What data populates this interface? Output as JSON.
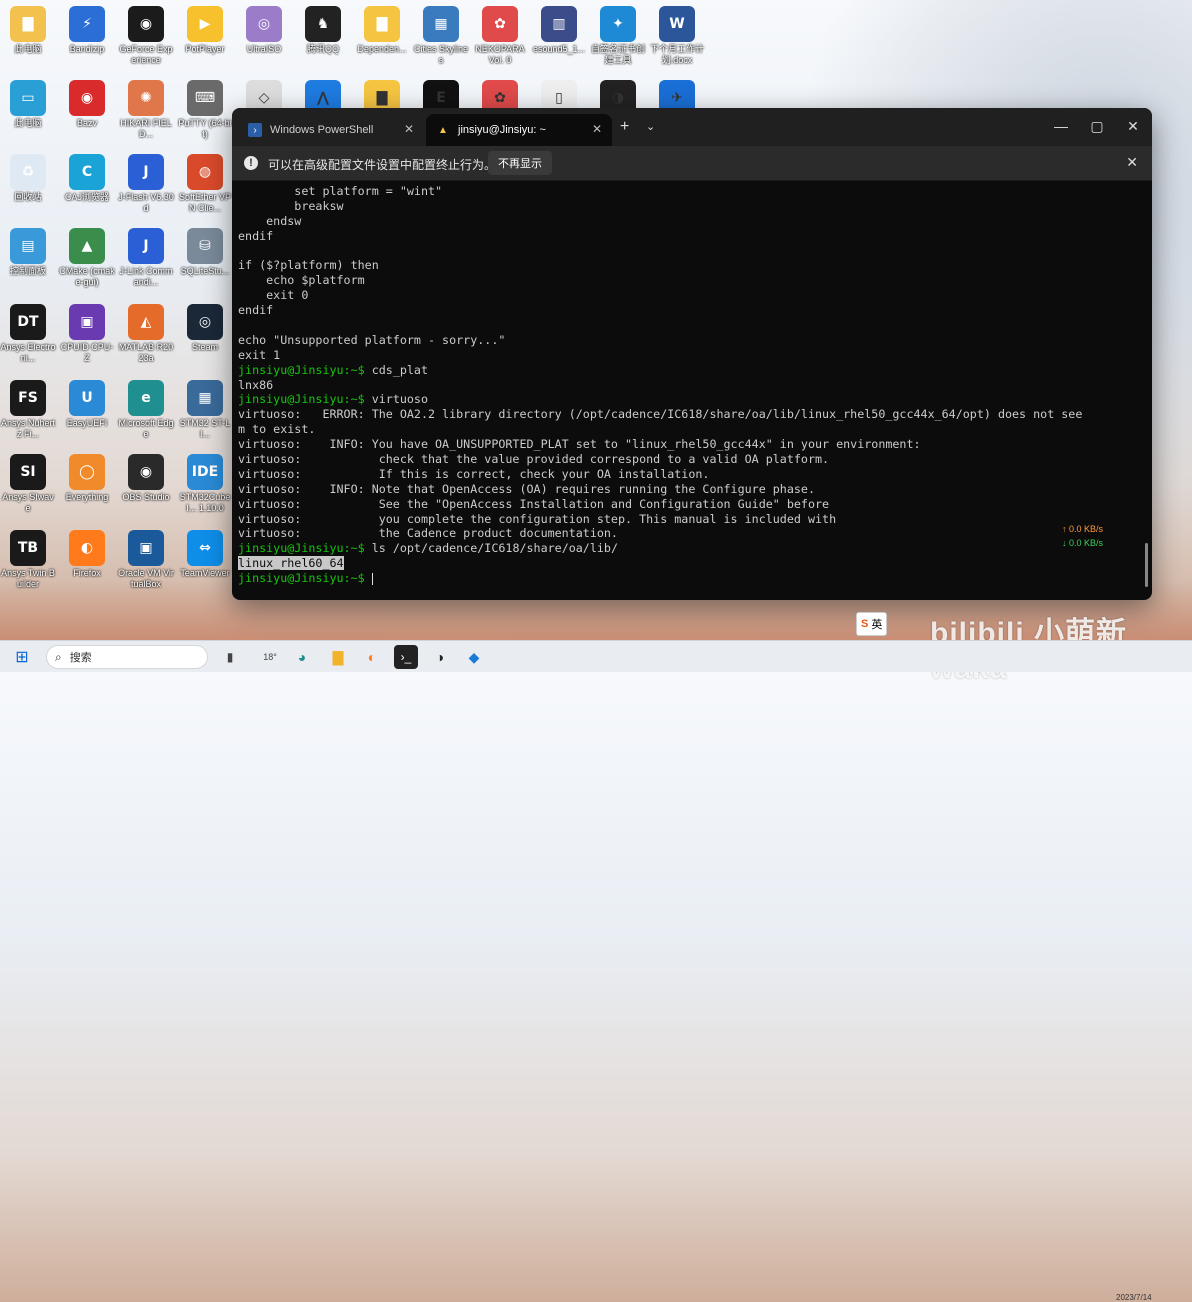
{
  "desktop_icons": [
    {
      "label": "此电脑",
      "icon": "folder-user-icon",
      "color": "#f2c14e",
      "glyph": "▇"
    },
    {
      "label": "Bandizip",
      "icon": "bandizip-icon",
      "color": "#2b6fd6",
      "glyph": "⚡"
    },
    {
      "label": "GeForce Experience",
      "icon": "nvidia-icon",
      "color": "#1b1b1b",
      "glyph": "◉"
    },
    {
      "label": "PotPlayer",
      "icon": "potplayer-icon",
      "color": "#f6c12c",
      "glyph": "▶"
    },
    {
      "label": "UltraISO",
      "icon": "disc-icon",
      "color": "#9b7cc9",
      "glyph": "◎"
    },
    {
      "label": "腾讯QQ",
      "icon": "qq-icon",
      "color": "#222222",
      "glyph": "♞"
    },
    {
      "label": "Dependen...",
      "icon": "folder-icon",
      "color": "#f5c542",
      "glyph": "▇"
    },
    {
      "label": "Cities Skylines",
      "icon": "cities-skylines-icon",
      "color": "#3a7bbf",
      "glyph": "▦"
    },
    {
      "label": "NEKOPARA Vol. 0",
      "icon": "paw-icon",
      "color": "#e04a4a",
      "glyph": "✿"
    },
    {
      "label": "esound5_1...",
      "icon": "building-icon",
      "color": "#3b4c8a",
      "glyph": "▥"
    },
    {
      "label": "自签名证书创建工具",
      "icon": "cert-tool-icon",
      "color": "#1e8ad6",
      "glyph": "✦"
    },
    {
      "label": "下个月工作计划.docx",
      "icon": "word-doc-icon",
      "color": "#2b579a",
      "glyph": "W"
    },
    {
      "label": "此电脑",
      "icon": "monitor-icon",
      "color": "#2a9fd6",
      "glyph": "▭"
    },
    {
      "label": "Bazv",
      "icon": "bazv-icon",
      "color": "#d92b2b",
      "glyph": "◉"
    },
    {
      "label": "HIKARI FIELD...",
      "icon": "hikari-icon",
      "color": "#e0774a",
      "glyph": "✺"
    },
    {
      "label": "PuTTY (64-bit)",
      "icon": "putty-icon",
      "color": "#6a6a6a",
      "glyph": "⌨"
    },
    {
      "label": "回收站",
      "icon": "recycle-bin-icon",
      "color": "#dfe9f3",
      "glyph": "♻"
    },
    {
      "label": "CAJ浏览器",
      "icon": "caj-icon",
      "color": "#1aa3d6",
      "glyph": "C"
    },
    {
      "label": "J-Flash V6.30d",
      "icon": "jflash-icon",
      "color": "#2a5fd6",
      "glyph": "J"
    },
    {
      "label": "SoftEther VPN Clie...",
      "icon": "softether-icon",
      "color": "#d94a2b",
      "glyph": "◍"
    },
    {
      "label": "控制面板",
      "icon": "control-panel-icon",
      "color": "#3a9ad9",
      "glyph": "▤"
    },
    {
      "label": "CMake (cmake-gui)",
      "icon": "cmake-icon",
      "color": "#3a8d4a",
      "glyph": "▲"
    },
    {
      "label": "J-Link Commandi...",
      "icon": "jlink-icon",
      "color": "#2a5fd6",
      "glyph": "J"
    },
    {
      "label": "SQLiteStu...",
      "icon": "database-icon",
      "color": "#7a8a9a",
      "glyph": "⛁"
    },
    {
      "label": "Ansys Electroni...",
      "icon": "ansys-dt-icon",
      "color": "#1a1a1a",
      "glyph": "DT"
    },
    {
      "label": "CPUID CPU-Z",
      "icon": "cpuz-icon",
      "color": "#6a3ab0",
      "glyph": "▣"
    },
    {
      "label": "MATLAB R2023a",
      "icon": "matlab-icon",
      "color": "#e56b2b",
      "glyph": "◭"
    },
    {
      "label": "Steam",
      "icon": "steam-icon",
      "color": "#1b2838",
      "glyph": "◎"
    },
    {
      "label": "Ansys Nuhertz Fi...",
      "icon": "ansys-fs-icon",
      "color": "#1a1a1a",
      "glyph": "FS"
    },
    {
      "label": "EasyUEFI",
      "icon": "easyuefi-icon",
      "color": "#2a8ad6",
      "glyph": "U"
    },
    {
      "label": "Microsoft Edge",
      "icon": "edge-icon",
      "color": "#1f8f8f",
      "glyph": "e"
    },
    {
      "label": "STM32 ST-LI...",
      "icon": "stm32-icon",
      "color": "#3a6a9a",
      "glyph": "▦"
    },
    {
      "label": "Ansys SIwave",
      "icon": "ansys-si-icon",
      "color": "#1a1a1a",
      "glyph": "SI"
    },
    {
      "label": "Everything",
      "icon": "everything-icon",
      "color": "#f08a2b",
      "glyph": "◯"
    },
    {
      "label": "OBS Studio",
      "icon": "obs-icon",
      "color": "#2a2a2a",
      "glyph": "◉"
    },
    {
      "label": "STM32CubeI... 1.10.0",
      "icon": "ide-icon",
      "color": "#2a8ad6",
      "glyph": "IDE"
    },
    {
      "label": "Ansys Twin Builder",
      "icon": "ansys-tb-icon",
      "color": "#1a1a1a",
      "glyph": "TB"
    },
    {
      "label": "Firefox",
      "icon": "firefox-icon",
      "color": "#ff7a1a",
      "glyph": "◐"
    },
    {
      "label": "Oracle VM VirtualBox",
      "icon": "virtualbox-icon",
      "color": "#1b5a9a",
      "glyph": "▣"
    },
    {
      "label": "TeamViewer",
      "icon": "teamviewer-icon",
      "color": "#0e8ee9",
      "glyph": "⇔"
    }
  ],
  "row2_extras": [
    {
      "icon": "unity-icon",
      "color": "#dddddd",
      "glyph": "◇"
    },
    {
      "icon": "lanhu-icon",
      "color": "#1e7be0",
      "glyph": "⋀"
    },
    {
      "icon": "folder-icon",
      "color": "#f5c542",
      "glyph": "▇"
    },
    {
      "icon": "epic-icon",
      "color": "#111111",
      "glyph": "E"
    },
    {
      "icon": "paw-icon",
      "color": "#e04a4a",
      "glyph": "✿"
    },
    {
      "icon": "file-icon",
      "color": "#eeeeee",
      "glyph": "▯"
    },
    {
      "icon": "davinci-icon",
      "color": "#222222",
      "glyph": "◑"
    },
    {
      "icon": "feishu-icon",
      "color": "#1a6fd6",
      "glyph": "✈"
    }
  ],
  "terminal": {
    "tabs": [
      {
        "label": "Windows PowerShell",
        "icon": "powershell-icon"
      },
      {
        "label": "jinsiyu@Jinsiyu: ~",
        "icon": "linux-icon"
      }
    ],
    "infobar": {
      "message": "可以在高级配置文件设置中配置终止行为。",
      "button": "不再显示"
    },
    "lines": [
      {
        "t": "        set platform = \"wint\""
      },
      {
        "t": "        breaksw"
      },
      {
        "t": "    endsw"
      },
      {
        "t": "endif"
      },
      {
        "t": ""
      },
      {
        "t": "if ($?platform) then"
      },
      {
        "t": "    echo $platform"
      },
      {
        "t": "    exit 0"
      },
      {
        "t": "endif"
      },
      {
        "t": ""
      },
      {
        "t": "echo \"Unsupported platform - sorry...\""
      },
      {
        "t": "exit 1"
      },
      {
        "p": "jinsiyu@Jinsiyu:~$",
        "t": " cds_plat"
      },
      {
        "t": "lnx86"
      },
      {
        "p": "jinsiyu@Jinsiyu:~$",
        "t": " virtuoso"
      },
      {
        "t": "virtuoso:   ERROR: The OA2.2 library directory (/opt/cadence/IC618/share/oa/lib/linux_rhel50_gcc44x_64/opt) does not see"
      },
      {
        "t": "m to exist."
      },
      {
        "t": "virtuoso:    INFO: You have OA_UNSUPPORTED_PLAT set to \"linux_rhel50_gcc44x\" in your environment:"
      },
      {
        "t": "virtuoso:           check that the value provided correspond to a valid OA platform."
      },
      {
        "t": "virtuoso:           If this is correct, check your OA installation."
      },
      {
        "t": "virtuoso:    INFO: Note that OpenAccess (OA) requires running the Configure phase."
      },
      {
        "t": "virtuoso:           See the \"OpenAccess Installation and Configuration Guide\" before"
      },
      {
        "t": "virtuoso:           you complete the configuration step. This manual is included with"
      },
      {
        "t": "virtuoso:           the Cadence product documentation."
      },
      {
        "p": "jinsiyu@Jinsiyu:~$",
        "t": " ls /opt/cadence/IC618/share/oa/lib/"
      },
      {
        "s": "linux_rhel60_64",
        "t": ""
      },
      {
        "p": "jinsiyu@Jinsiyu:~$",
        "t": " ",
        "cursor": true
      }
    ],
    "colors": {
      "prompt": "#16c60c",
      "text": "#cccccc",
      "bg": "#0c0c0c"
    }
  },
  "network": {
    "up": "↑ 0.0 KB/s",
    "down": "↓ 0.0 KB/s"
  },
  "taskbar": {
    "search_placeholder": "搜索",
    "weather": "18°",
    "items": [
      "start-icon",
      "search-icon",
      "files-icon",
      "weather-icon",
      "edge-icon",
      "explorer-icon",
      "firefox-icon",
      "terminal-icon",
      "davinci-icon",
      "vscode-icon"
    ]
  },
  "ime": {
    "label": "英"
  },
  "watermark": {
    "text": "bilibili 小萌新 waka",
    "date": "2023/7/14"
  }
}
